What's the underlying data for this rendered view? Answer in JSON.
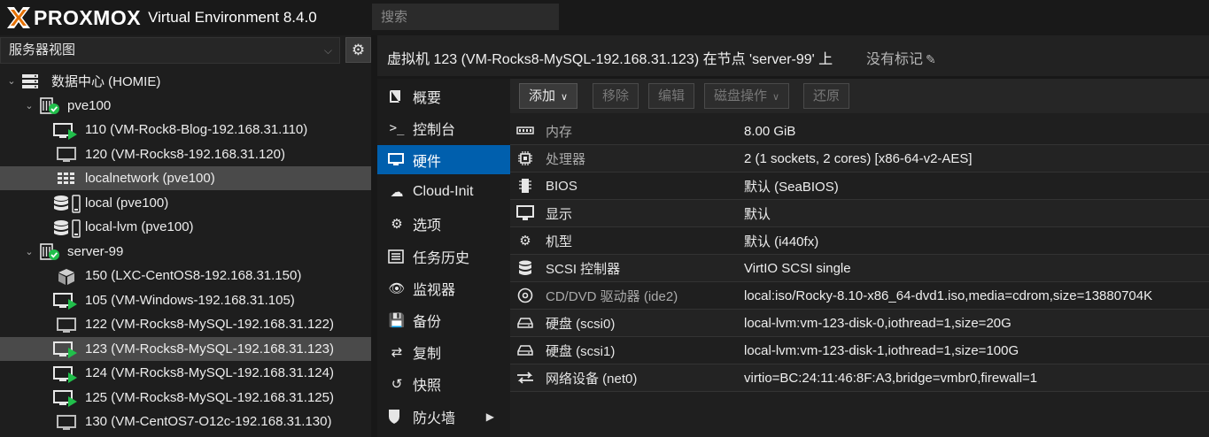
{
  "brand": {
    "logo_text": "PROXMOX",
    "version_text": "Virtual Environment 8.4.0"
  },
  "search": {
    "placeholder": "搜索"
  },
  "view_selector": {
    "value": "服务器视图"
  },
  "tree": [
    {
      "label": "数据中心 (HOMIE)",
      "icon": "datacenter-icon",
      "level": 0,
      "expanded": true
    },
    {
      "label": "pve100",
      "icon": "node-online-icon",
      "level": 1,
      "expanded": true
    },
    {
      "label": "110 (VM-Rock8-Blog-192.168.31.110)",
      "icon": "vm-running-icon",
      "level": 2
    },
    {
      "label": "120 (VM-Rocks8-192.168.31.120)",
      "icon": "vm-stopped-icon",
      "level": 2
    },
    {
      "label": "localnetwork (pve100)",
      "icon": "sdn-network-icon",
      "level": 2,
      "selected": true
    },
    {
      "label": "local (pve100)",
      "icon": "storage-icon",
      "level": 2
    },
    {
      "label": "local-lvm (pve100)",
      "icon": "storage-icon",
      "level": 2
    },
    {
      "label": "server-99",
      "icon": "node-online-icon",
      "level": 1,
      "expanded": true
    },
    {
      "label": "150 (LXC-CentOS8-192.168.31.150)",
      "icon": "container-icon",
      "level": 2
    },
    {
      "label": "105 (VM-Windows-192.168.31.105)",
      "icon": "vm-running-icon",
      "level": 2
    },
    {
      "label": "122 (VM-Rocks8-MySQL-192.168.31.122)",
      "icon": "vm-stopped-icon",
      "level": 2
    },
    {
      "label": "123 (VM-Rocks8-MySQL-192.168.31.123)",
      "icon": "vm-running-icon",
      "level": 2,
      "selected": true
    },
    {
      "label": "124 (VM-Rocks8-MySQL-192.168.31.124)",
      "icon": "vm-running-icon",
      "level": 2
    },
    {
      "label": "125 (VM-Rocks8-MySQL-192.168.31.125)",
      "icon": "vm-running-icon",
      "level": 2
    },
    {
      "label": "130 (VM-CentOS7-O12c-192.168.31.130)",
      "icon": "vm-stopped-icon",
      "level": 2
    }
  ],
  "header": {
    "title": "虚拟机 123 (VM-Rocks8-MySQL-192.168.31.123) 在节点 'server-99' 上",
    "tags_label": "没有标记"
  },
  "nav": [
    {
      "label": "概要",
      "icon": "book-icon"
    },
    {
      "label": "控制台",
      "icon": "terminal-icon"
    },
    {
      "label": "硬件",
      "icon": "monitor-icon",
      "selected": true
    },
    {
      "label": "Cloud-Init",
      "icon": "cloud-icon"
    },
    {
      "label": "选项",
      "icon": "gear-icon"
    },
    {
      "label": "任务历史",
      "icon": "list-icon"
    },
    {
      "label": "监视器",
      "icon": "eye-icon"
    },
    {
      "label": "备份",
      "icon": "floppy-icon"
    },
    {
      "label": "复制",
      "icon": "retweet-icon"
    },
    {
      "label": "快照",
      "icon": "history-icon"
    },
    {
      "label": "防火墙",
      "icon": "shield-icon",
      "has_submenu": true
    }
  ],
  "toolbar": {
    "add": "添加",
    "remove": "移除",
    "edit": "编辑",
    "disk_action": "磁盘操作",
    "revert": "还原"
  },
  "hardware": [
    {
      "name": "内存",
      "value": "8.00 GiB",
      "icon": "memory-icon",
      "dim": true
    },
    {
      "name": "处理器",
      "value": "2 (1 sockets, 2 cores) [x86-64-v2-AES]",
      "icon": "cpu-icon",
      "dim": true
    },
    {
      "name": "BIOS",
      "value": "默认 (SeaBIOS)",
      "icon": "microchip-icon"
    },
    {
      "name": "显示",
      "value": "默认",
      "icon": "desktop-icon"
    },
    {
      "name": "机型",
      "value": "默认 (i440fx)",
      "icon": "cogs-icon"
    },
    {
      "name": "SCSI 控制器",
      "value": "VirtIO SCSI single",
      "icon": "database-icon"
    },
    {
      "name": "CD/DVD 驱动器 (ide2)",
      "value": "local:iso/Rocky-8.10-x86_64-dvd1.iso,media=cdrom,size=13880704K",
      "icon": "cdrom-icon",
      "dim": true
    },
    {
      "name": "硬盘 (scsi0)",
      "value": "local-lvm:vm-123-disk-0,iothread=1,size=20G",
      "icon": "harddisk-icon"
    },
    {
      "name": "硬盘 (scsi1)",
      "value": "local-lvm:vm-123-disk-1,iothread=1,size=100G",
      "icon": "harddisk-icon"
    },
    {
      "name": "网络设备 (net0)",
      "value": "virtio=BC:24:11:46:8F:A3,bridge=vmbr0,firewall=1",
      "icon": "exchange-icon"
    }
  ],
  "colors": {
    "accent": "#005fad",
    "logo_orange": "#e57000",
    "status_green": "#21bf4b"
  }
}
